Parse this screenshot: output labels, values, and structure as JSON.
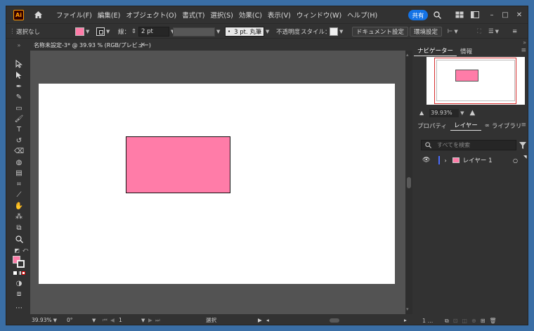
{
  "app": {
    "logo": "Ai",
    "menus": [
      "ファイル(F)",
      "編集(E)",
      "オブジェクト(O)",
      "書式(T)",
      "選択(S)",
      "効果(C)",
      "表示(V)",
      "ウィンドウ(W)",
      "ヘルプ(H)"
    ],
    "share_label": "共有"
  },
  "control_bar": {
    "selection": "選択なし",
    "stroke_label": "線：",
    "stroke_weight": "2 pt",
    "brush": "3 pt. 丸筆",
    "opacity_label": "不透明度",
    "style_label": "スタイル：",
    "document_settings": "ドキュメント設定",
    "preferences": "環境設定"
  },
  "document": {
    "tab_title": "名称未設定-3* @ 39.93 % (RGB/プレビュー)",
    "close": "×"
  },
  "status_bar": {
    "zoom": "39.93%",
    "rotation": "0°",
    "artboard": "1",
    "tool": "選択"
  },
  "navigator": {
    "tabs": [
      "ナビゲーター",
      "情報"
    ],
    "zoom": "39.93%"
  },
  "layers_panel": {
    "tabs": [
      "プロパティ",
      "レイヤー",
      "ライブラリ"
    ],
    "search_placeholder": "すべてを検索",
    "layers": [
      {
        "name": "レイヤー 1",
        "color": "#4a6cff"
      }
    ],
    "count": "1 ..."
  },
  "colors": {
    "accent": "#1473e6",
    "fill": "#ff7ca8",
    "artboard": "#ffffff",
    "pasteboard": "#535353",
    "chrome": "#323232"
  }
}
